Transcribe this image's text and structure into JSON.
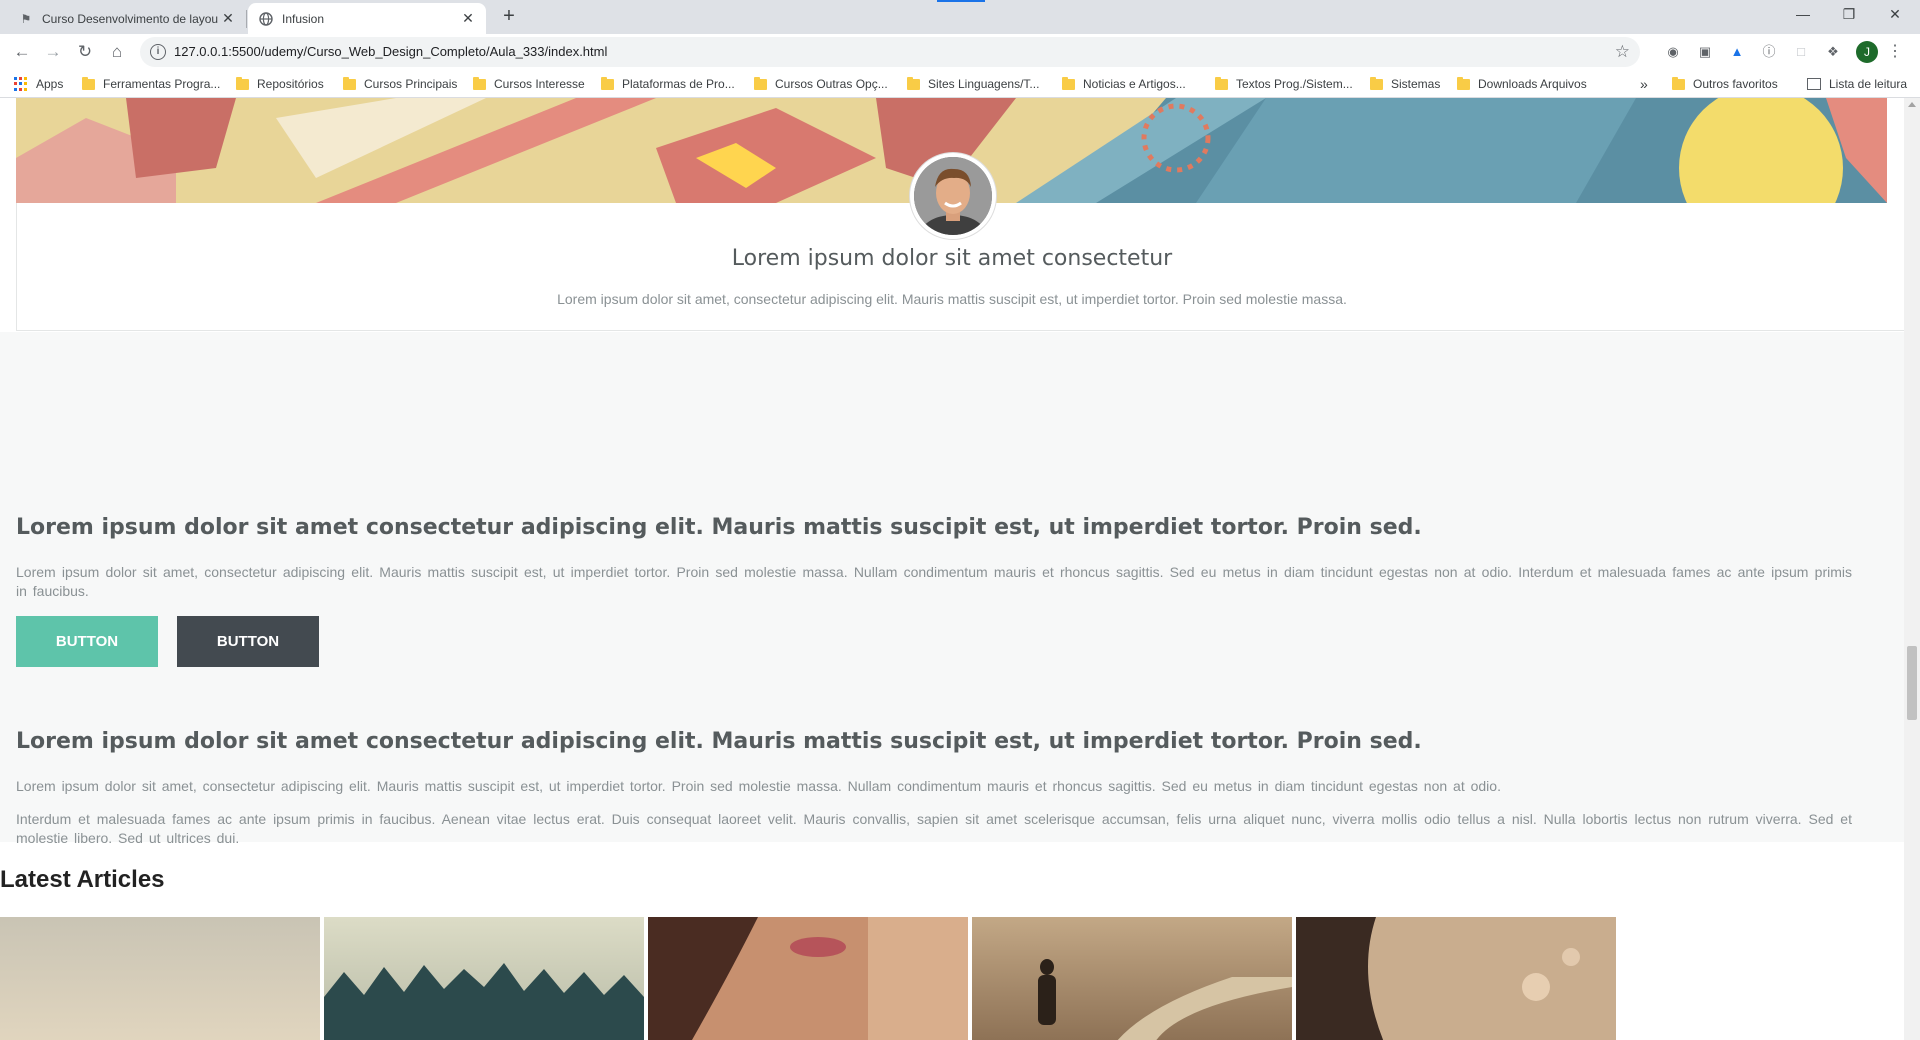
{
  "browser": {
    "tabs": [
      {
        "title": "Curso Desenvolvimento de layou",
        "active": false
      },
      {
        "title": "Infusion",
        "active": true
      }
    ],
    "url": "127.0.0.1:5500/udemy/Curso_Web_Design_Completo/Aula_333/index.html",
    "profile_initial": "J",
    "bookmarks": [
      "Apps",
      "Ferramentas Progra...",
      "Repositórios",
      "Cursos Principais",
      "Cursos Interesse",
      "Plataformas de Pro...",
      "Cursos Outras Opç...",
      "Sites Linguagens/T...",
      "Noticias e Artigos...",
      "Textos Prog./Sistem...",
      "Sistemas",
      "Downloads Arquivos"
    ],
    "bookmarks_overflow": "»",
    "other_bookmarks": "Outros favoritos",
    "reading_list": "Lista de leitura"
  },
  "page": {
    "profile": {
      "title": "Lorem ipsum dolor sit amet consectetur",
      "text": "Lorem ipsum dolor sit amet, consectetur adipiscing elit. Mauris mattis suscipit est, ut imperdiet tortor. Proin sed molestie massa."
    },
    "block1": {
      "heading": "Lorem ipsum dolor sit amet consectetur adipiscing elit. Mauris mattis suscipit est, ut imperdiet tortor. Proin sed.",
      "paragraph": "Lorem ipsum dolor sit amet, consectetur adipiscing elit. Mauris mattis suscipit est, ut imperdiet tortor. Proin sed molestie massa. Nullam condimentum mauris et rhoncus sagittis. Sed eu metus in diam tincidunt egestas non at odio. Interdum et malesuada fames ac ante ipsum primis in faucibus.",
      "button_primary": "BUTTON",
      "button_secondary": "BUTTON"
    },
    "block2": {
      "heading": "Lorem ipsum dolor sit amet consectetur adipiscing elit. Mauris mattis suscipit est, ut imperdiet tortor. Proin sed.",
      "paragraph1": "Lorem ipsum dolor sit amet, consectetur adipiscing elit. Mauris mattis suscipit est, ut imperdiet tortor. Proin sed molestie massa. Nullam condimentum mauris et rhoncus sagittis. Sed eu metus in diam tincidunt egestas non at odio.",
      "paragraph2": "Interdum et malesuada fames ac ante ipsum primis in faucibus. Aenean vitae lectus erat. Duis consequat laoreet velit. Mauris convallis, sapien sit amet scelerisque accumsan, felis urna aliquet nunc, viverra mollis odio tellus a nisl. Nulla lobortis lectus non rutrum viverra. Sed et molestie libero. Sed ut ultrices dui."
    },
    "articles_title": "Latest Articles"
  },
  "colors": {
    "accent_teal": "#5ec4aa",
    "dark_button": "#434a50",
    "section_gray": "#f7f8f8"
  }
}
